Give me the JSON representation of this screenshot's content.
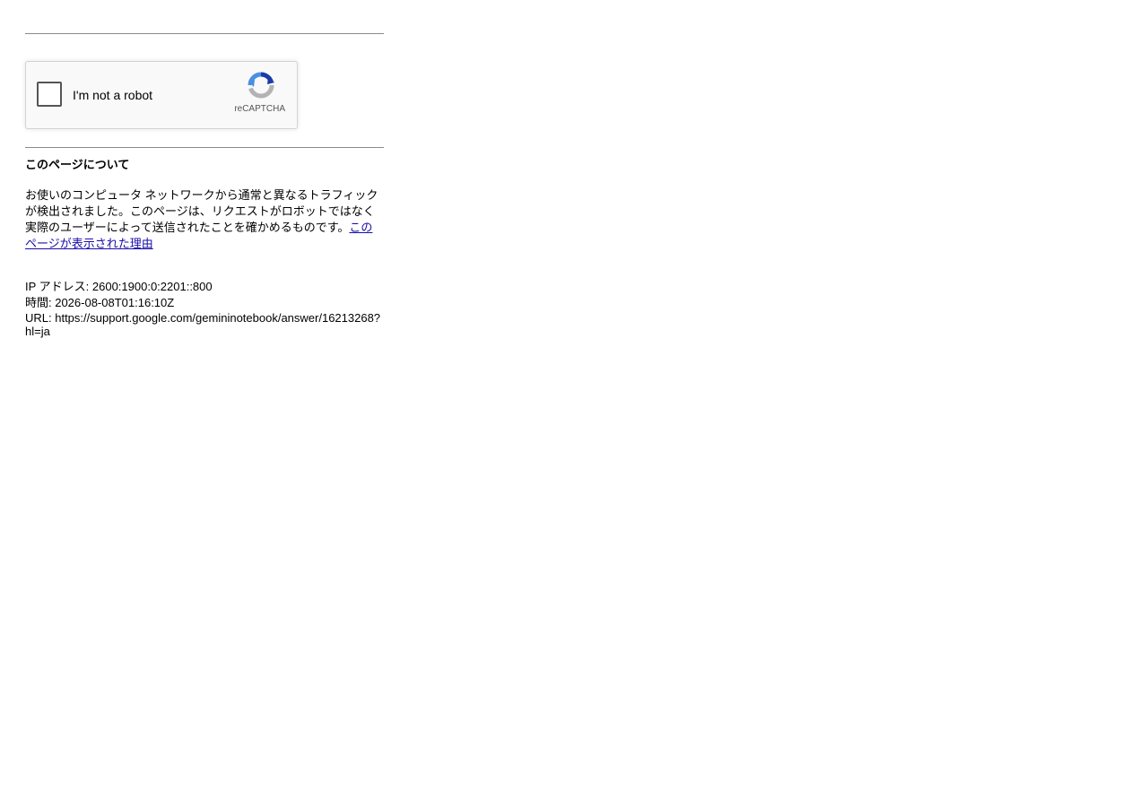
{
  "recaptcha": {
    "checkbox_label": "I'm not a robot",
    "brand_label": "reCAPTCHA",
    "logo_icon": "recaptcha-logo-icon",
    "colors": {
      "blue": "#1c3aa9",
      "light_blue": "#4a90e2",
      "grey": "#b3b3b3"
    }
  },
  "about": {
    "title": "このページについて",
    "body": "お使いのコンピュータ ネットワークから通常と異なるトラフィックが検出されました。このページは、リクエストがロボットではなく実際のユーザーによって送信されたことを確かめるものです。",
    "link_label": "このページが表示された理由"
  },
  "meta": {
    "ip": "IP アドレス: 2600:1900:0:2201::800",
    "time": "時間: 2026-08-08T01:16:10Z",
    "url": "URL: https://support.google.com/gemininotebook/answer/16213268?hl=ja"
  }
}
